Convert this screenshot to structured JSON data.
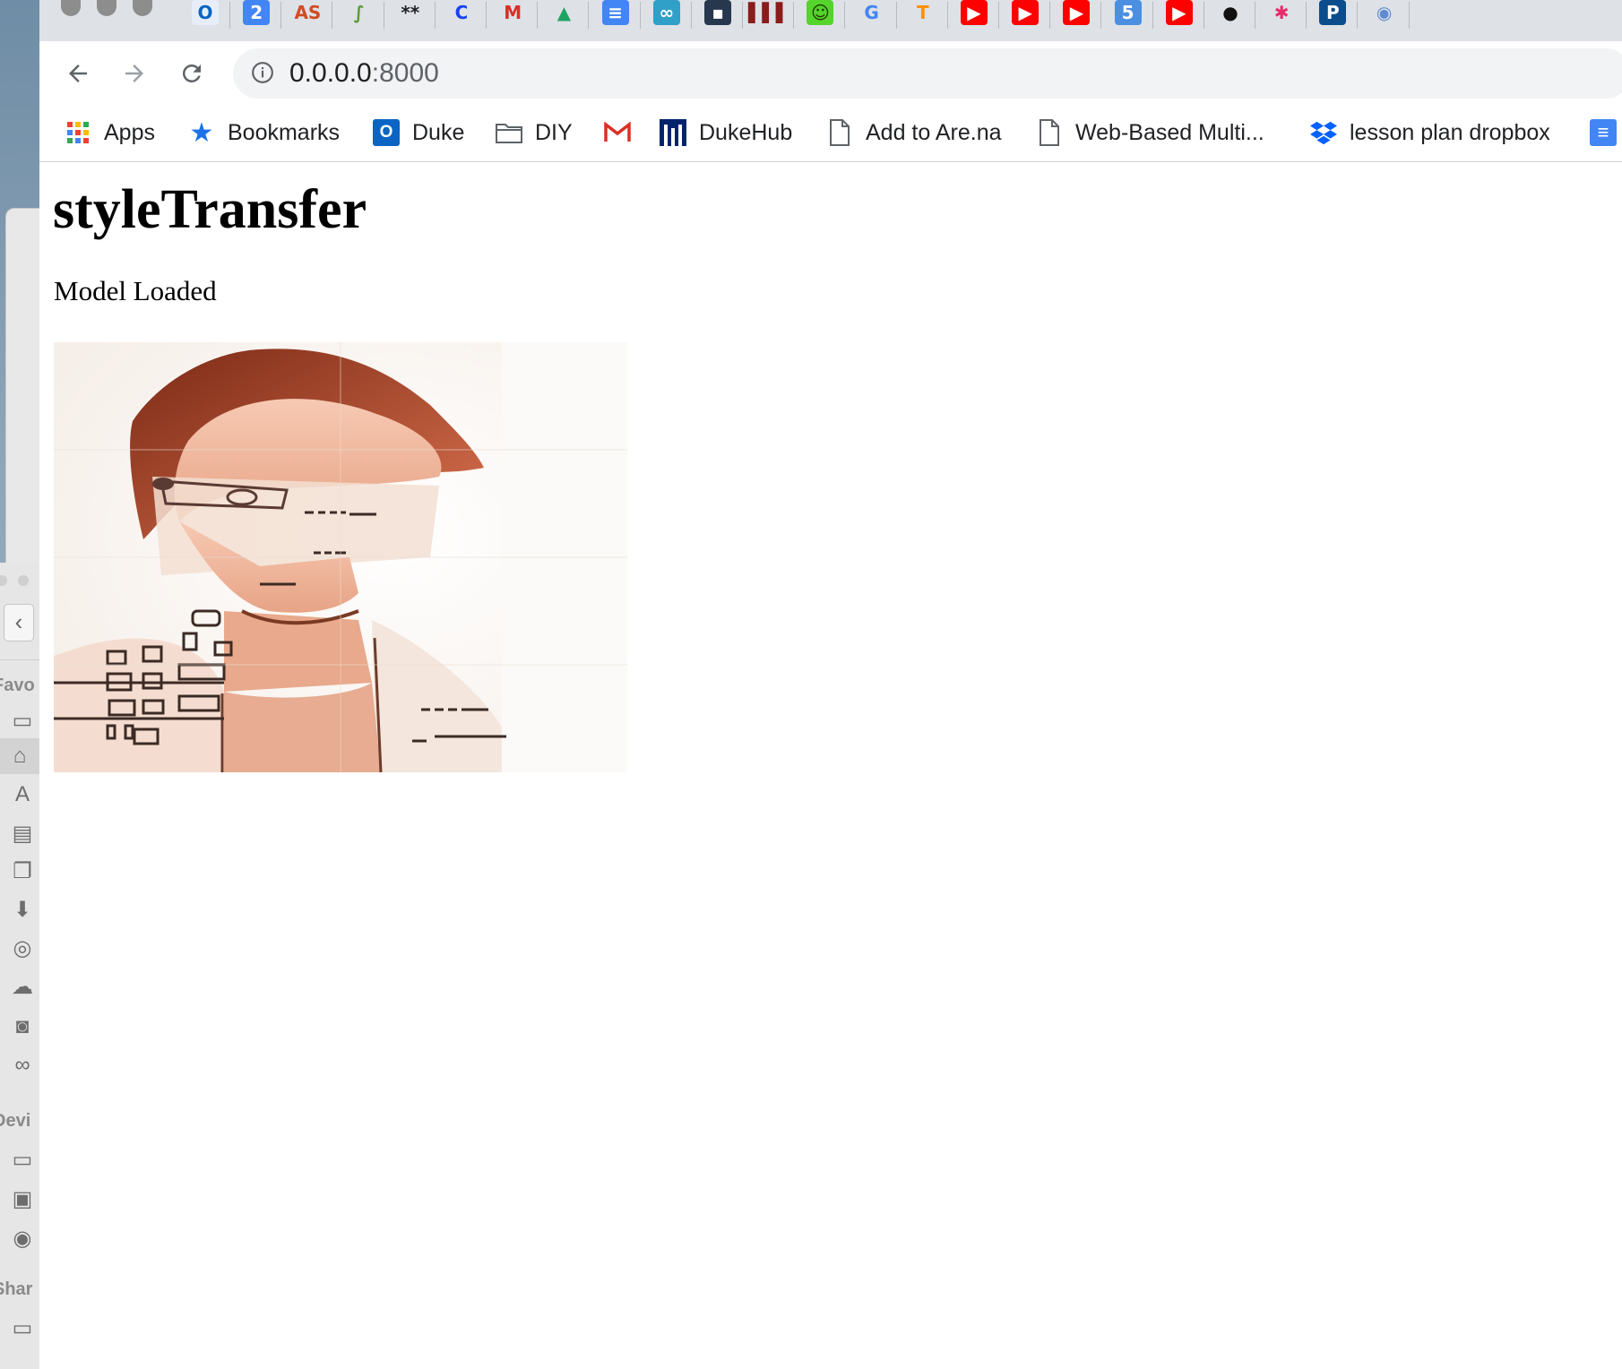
{
  "browser": {
    "url_host": "0.0.0.0",
    "url_port": ":8000",
    "tab_favicons": [
      {
        "name": "outlook-icon",
        "glyph": "O",
        "color": "#0a64c4",
        "bg": "#e7eefa"
      },
      {
        "name": "calendar-icon",
        "glyph": "2",
        "color": "#ffffff",
        "bg": "#4285f4"
      },
      {
        "name": "asap-icon",
        "glyph": "AS",
        "color": "#d24c25",
        "bg": "transparent"
      },
      {
        "name": "feather-icon",
        "glyph": "∫",
        "color": "#5b9b3a",
        "bg": "transparent"
      },
      {
        "name": "asterisks-icon",
        "glyph": "**",
        "color": "#202124",
        "bg": "transparent"
      },
      {
        "name": "c-logo-icon",
        "glyph": "C",
        "color": "#1a3ff5",
        "bg": "transparent"
      },
      {
        "name": "gmail-icon",
        "glyph": "M",
        "color": "#d93025",
        "bg": "transparent"
      },
      {
        "name": "drive-icon",
        "glyph": "▲",
        "color": "#1fa463",
        "bg": "transparent"
      },
      {
        "name": "docs-icon",
        "glyph": "≡",
        "color": "#ffffff",
        "bg": "#4285f4"
      },
      {
        "name": "infinity-icon",
        "glyph": "∞",
        "color": "#ffffff",
        "bg": "#30a0c8"
      },
      {
        "name": "data-science-icon",
        "glyph": "▪",
        "color": "#ffffff",
        "bg": "#27374d"
      },
      {
        "name": "duke-bars-icon",
        "glyph": "▌▌▌",
        "color": "#8a1c1c",
        "bg": "transparent"
      },
      {
        "name": "smiley-icon",
        "glyph": "☺",
        "color": "#1d3b00",
        "bg": "#55d42b"
      },
      {
        "name": "google-icon",
        "glyph": "G",
        "color": "#4285f4",
        "bg": "transparent"
      },
      {
        "name": "tensorflow-icon",
        "glyph": "T",
        "color": "#ff8f00",
        "bg": "transparent"
      },
      {
        "name": "youtube-icon",
        "glyph": "▶",
        "color": "#ffffff",
        "bg": "#ff0000"
      },
      {
        "name": "youtube-icon",
        "glyph": "▶",
        "color": "#ffffff",
        "bg": "#ff0000"
      },
      {
        "name": "youtube-icon",
        "glyph": "▶",
        "color": "#ffffff",
        "bg": "#ff0000"
      },
      {
        "name": "five-icon",
        "glyph": "5",
        "color": "#ffffff",
        "bg": "#4a8fe2"
      },
      {
        "name": "youtube-icon",
        "glyph": "▶",
        "color": "#ffffff",
        "bg": "#ff0000"
      },
      {
        "name": "github-icon",
        "glyph": "●",
        "color": "#111111",
        "bg": "transparent"
      },
      {
        "name": "asterisk-icon",
        "glyph": "✱",
        "color": "#e62c6a",
        "bg": "transparent"
      },
      {
        "name": "p-logo-icon",
        "glyph": "P",
        "color": "#ffffff",
        "bg": "#0b4d8c"
      },
      {
        "name": "globe-icon",
        "glyph": "◉",
        "color": "#5f8bd0",
        "bg": "transparent"
      }
    ]
  },
  "bookmarks": [
    {
      "label": "Apps"
    },
    {
      "label": "Bookmarks"
    },
    {
      "label": "Duke"
    },
    {
      "label": "DIY"
    },
    {
      "label": ""
    },
    {
      "label": "DukeHub"
    },
    {
      "label": "Add to Are.na"
    },
    {
      "label": "Web-Based Multi..."
    },
    {
      "label": "lesson plan dropbox"
    }
  ],
  "finder": {
    "sections": [
      "Favo",
      "Devi",
      "Shar"
    ]
  },
  "page": {
    "title": "styleTransfer",
    "status": "Model Loaded"
  }
}
